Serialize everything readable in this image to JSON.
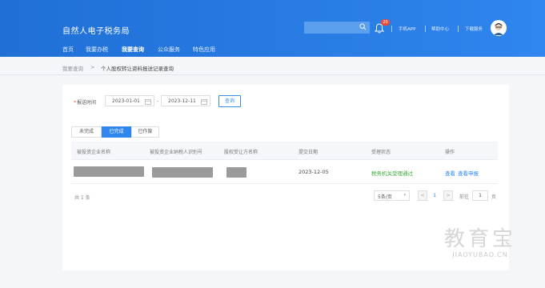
{
  "header": {
    "site_title": "自然人电子税务局",
    "notification_count": "20",
    "links": [
      "手机APP",
      "帮助中心",
      "下载服务"
    ]
  },
  "nav": {
    "items": [
      "首页",
      "我要办税",
      "我要查询",
      "公众服务",
      "特色应用"
    ],
    "active_index": 2
  },
  "breadcrumb": {
    "root": "我要查询",
    "separator": ">",
    "current": "个人股权转让资料报送记录查询"
  },
  "filter": {
    "required_mark": "*",
    "label": "报送时间",
    "start_date": "2023-01-01",
    "separator": "-",
    "end_date": "2023-12-11",
    "query_label": "查询"
  },
  "tabs": [
    {
      "label": "未完成",
      "active": false
    },
    {
      "label": "已完成",
      "active": true
    },
    {
      "label": "已作废",
      "active": false
    }
  ],
  "table": {
    "columns": [
      "被投资企业名称",
      "被投资企业纳税人识别号",
      "股权受让方名称",
      "提交日期",
      "受理状态",
      "操作"
    ],
    "rows": [
      {
        "submit_date": "2023-12-05",
        "status": "税务机关受理通过",
        "actions": [
          "查看",
          "查看申报"
        ]
      }
    ]
  },
  "pagination": {
    "total_text": "共 1 条",
    "page_size": "5条/页",
    "prev": "<",
    "current_page": "1",
    "next": ">",
    "goto_label": "前往",
    "goto_value": "1",
    "page_unit": "页"
  },
  "watermark": {
    "cn": "教育宝",
    "en": "JIAOYUBAO.CN"
  },
  "colors": {
    "header_blue": "#2f86ee",
    "status_green": "#3aab3a",
    "link_blue": "#2f86ee",
    "badge_red": "#e94b35"
  }
}
